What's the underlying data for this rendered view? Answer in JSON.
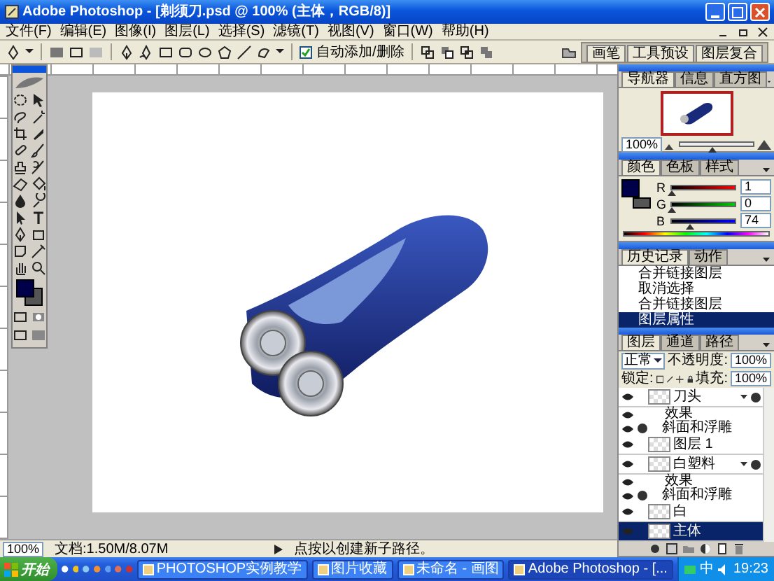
{
  "window": {
    "title": "Adobe Photoshop - [剃须刀.psd @ 100% (主体，RGB/8)]"
  },
  "menu": [
    "文件(F)",
    "编辑(E)",
    "图像(I)",
    "图层(L)",
    "选择(S)",
    "滤镜(T)",
    "视图(V)",
    "窗口(W)",
    "帮助(H)"
  ],
  "options_bar": {
    "auto_add_delete": {
      "label": "自动添加/删除",
      "checked": true
    },
    "palette_tabs": [
      "画笔",
      "工具预设",
      "图层复合"
    ]
  },
  "navigator": {
    "tabs": [
      {
        "label": "导航器",
        "selected": true
      },
      {
        "label": "信息",
        "selected": false
      },
      {
        "label": "直方图",
        "selected": false
      }
    ],
    "zoom": "100%",
    "level": 0.45
  },
  "color": {
    "tabs": [
      {
        "label": "颜色",
        "selected": true
      },
      {
        "label": "色板",
        "selected": false
      },
      {
        "label": "样式",
        "selected": false
      }
    ],
    "channels": [
      {
        "name": "R",
        "value": "1",
        "level": 0.004
      },
      {
        "name": "G",
        "value": "0",
        "level": 0
      },
      {
        "name": "B",
        "value": "74",
        "level": 0.29
      }
    ]
  },
  "history": {
    "tabs": [
      {
        "label": "历史记录",
        "selected": true
      },
      {
        "label": "动作",
        "selected": false
      }
    ],
    "items": [
      {
        "label": "合并链接图层",
        "selected": false
      },
      {
        "label": "取消选择",
        "selected": false
      },
      {
        "label": "合并链接图层",
        "selected": false
      },
      {
        "label": "图层属性",
        "selected": true
      }
    ]
  },
  "layers": {
    "tabs": [
      {
        "label": "图层",
        "selected": true
      },
      {
        "label": "通道",
        "selected": false
      },
      {
        "label": "路径",
        "selected": false
      }
    ],
    "blend_mode": "正常",
    "opacity_label": "不透明度:",
    "opacity": "100%",
    "lock_label": "锁定:",
    "fill_label": "填充:",
    "fill": "100%",
    "items": [
      {
        "name": "刀头",
        "selected": false,
        "effects": {
          "label": "效果",
          "items": [
            "斜面和浮雕"
          ]
        }
      },
      {
        "name": "图层 1",
        "selected": false
      },
      {
        "name": "白塑料",
        "selected": false,
        "effects": {
          "label": "效果",
          "items": [
            "斜面和浮雕"
          ]
        }
      },
      {
        "name": "白",
        "selected": false
      },
      {
        "name": "主体",
        "selected": true
      }
    ]
  },
  "status_bar": {
    "zoom": "100%",
    "doc": "文档:1.50M/8.07M",
    "hint": "点按以创建新子路径。"
  },
  "taskbar": {
    "start": "开始",
    "tasks": [
      {
        "label": "PHOTOSHOP实例教学",
        "selected": false
      },
      {
        "label": "图片收藏",
        "selected": false
      },
      {
        "label": "未命名 - 画图",
        "selected": false
      },
      {
        "label": "Adobe Photoshop - [...",
        "selected": true
      }
    ],
    "ime": "中",
    "clock": "19:23"
  }
}
